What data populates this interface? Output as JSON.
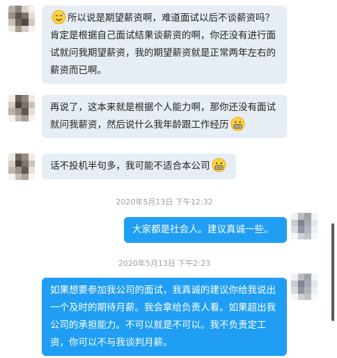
{
  "messages": [
    {
      "direction": "in",
      "text_after_emoji": "所以说是期望薪资啊，难道面试以后不谈薪资吗？肯定是根据自己面试结果谈薪资的啊，你还没有进行面试就问我期望薪资，我的期望薪资就是正常两年左右的薪资而已啊。",
      "emoji": "sweat-smile-emoji"
    },
    {
      "direction": "in",
      "text": "再说了，这本来就是根据个人能力啊，那你还没有面试就问我薪资，然后说什么我年龄跟工作经历",
      "emoji": "grimace-emoji"
    },
    {
      "direction": "in",
      "text": "话不投机半句多，我可能不适合本公司",
      "emoji": "grimace-emoji"
    },
    {
      "timestamp": "2020年5月13日 下午12:32"
    },
    {
      "direction": "out",
      "text": "大家都是社会人。建议真诚一些。"
    },
    {
      "timestamp": "2020年5月13日 下午2:23"
    },
    {
      "direction": "out",
      "text": "如果想要参加我公司的面试，我真诚的建议你给我说出一个及时的期待月薪。我会拿给负责人看。如果超出我公司的承担能力。不可以就是不可以。我不负责定工资，你可以不与我谈判月薪。"
    }
  ],
  "colors": {
    "incoming_bubble": "#e6edf4",
    "outgoing_bubble": "#1f9ef3",
    "timestamp_text": "#9a9fa6"
  }
}
